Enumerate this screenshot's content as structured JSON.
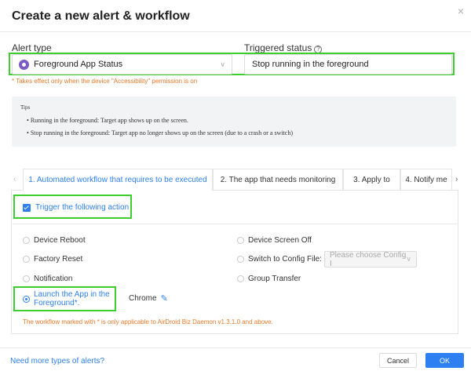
{
  "dialog": {
    "title": "Create a new alert & workflow",
    "close_glyph": "×"
  },
  "alert_type": {
    "label": "Alert type",
    "value": "Foreground App Status",
    "icon": "app-status-icon"
  },
  "triggered_status": {
    "label": "Triggered status",
    "help_glyph": "?",
    "value": "Stop running in the foreground"
  },
  "accessibility_hint": "* Takes effect only when the device \"Accessibility\" permission is on",
  "tips": {
    "title": "Tips",
    "items": [
      "Running in the foreground: Target app shows up on the screen.",
      "Stop running in the foreground: Target app no longer shows up on the screen (due to a crash or a switch)"
    ]
  },
  "tabs": [
    "1. Automated workflow that requires to be executed",
    "2. The app that needs monitoring",
    "3. Apply to",
    "4. Notify me"
  ],
  "trigger": {
    "label": "Trigger the following action",
    "checked": true
  },
  "actions": {
    "left": [
      "Device Reboot",
      "Factory Reset",
      "Notification",
      "Launch the App in the Foreground*."
    ],
    "right": [
      "Device Screen Off",
      "Switch to Config File:",
      "Group Transfer"
    ],
    "selected": "Launch the App in the Foreground*.",
    "config_placeholder": "Please choose Config I",
    "launch_app": "Chrome"
  },
  "workflow_note": "The workflow marked with * is only applicable to AirDroid Biz Daemon v1.3.1.0 and above.",
  "footer": {
    "link": "Need more types of alerts?",
    "cancel": "Cancel",
    "ok": "OK"
  },
  "colors": {
    "accent": "#2d7ff2",
    "highlight": "#3ccf2e",
    "warning": "#e87a2a"
  }
}
